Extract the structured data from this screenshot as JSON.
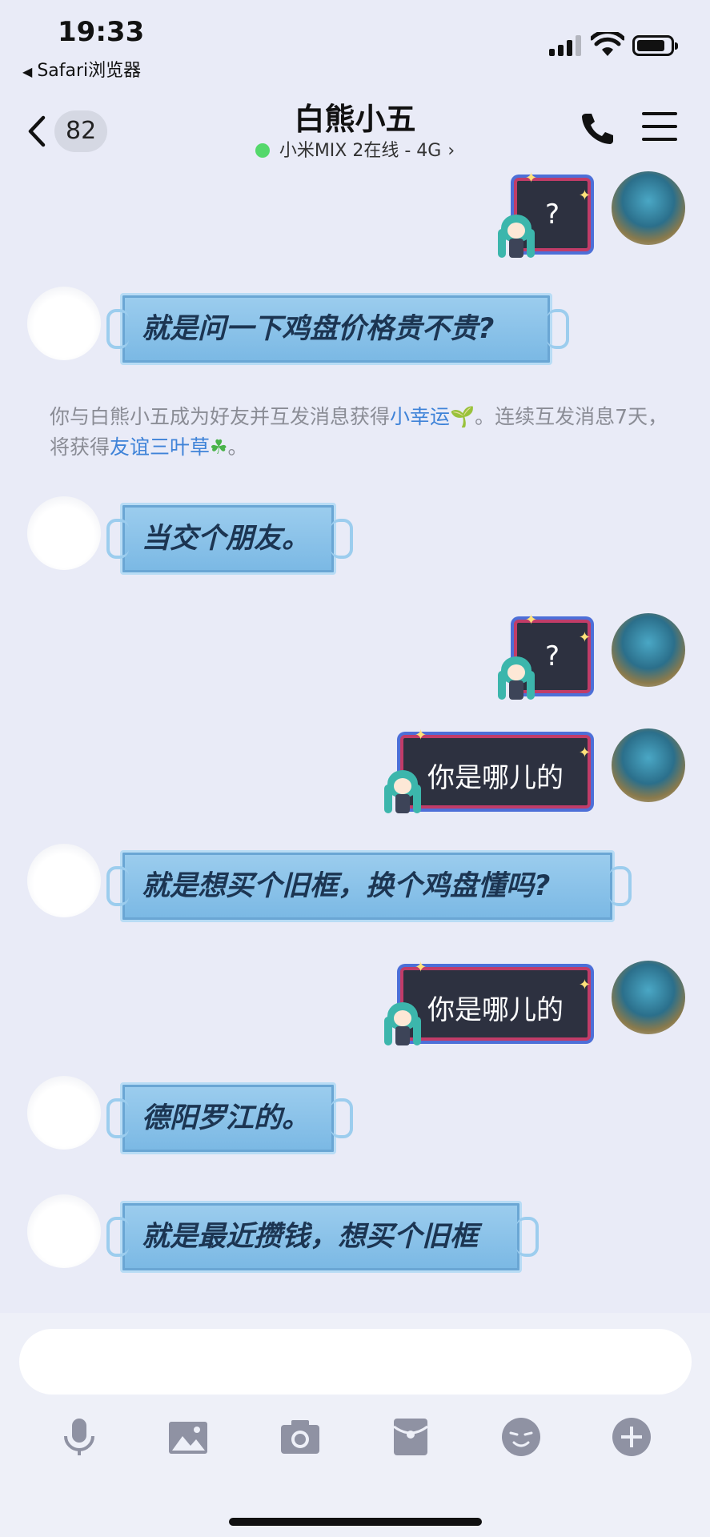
{
  "status_bar": {
    "time": "19:33",
    "back_app_label": "Safari浏览器"
  },
  "header": {
    "unread_count": "82",
    "title": "白熊小五",
    "subtitle": "小米MIX 2在线 - 4G",
    "online_color": "#54d86b"
  },
  "messages": [
    {
      "side": "out",
      "text": "?"
    },
    {
      "side": "in",
      "text": "就是问一下鸡盘价格贵不贵?"
    },
    {
      "side": "in",
      "text": "当交个朋友。"
    },
    {
      "side": "out",
      "text": "?"
    },
    {
      "side": "out",
      "text": "你是哪儿的"
    },
    {
      "side": "in",
      "text": "就是想买个旧框，换个鸡盘懂吗?"
    },
    {
      "side": "out",
      "text": "你是哪儿的"
    },
    {
      "side": "in",
      "text": "德阳罗江的。"
    },
    {
      "side": "in",
      "text": "就是最近攒钱，想买个旧框"
    }
  ],
  "system_notice": {
    "part1": "你与白熊小五成为好友并互发消息获得",
    "link1": "小幸运",
    "part2": "。连续互发消息7天，将获得",
    "link2": "友谊三叶草",
    "part3": "。"
  },
  "input": {
    "value": ""
  },
  "toolbar": {
    "icons": [
      "microphone-icon",
      "image-icon",
      "camera-icon",
      "red-packet-icon",
      "emoji-icon",
      "plus-icon"
    ]
  },
  "colors": {
    "background": "#e9ebf7",
    "incoming_bubble": "#7ab8e4",
    "outgoing_bubble": "#2d3140",
    "outgoing_border": "#c13c68",
    "link": "#3f83d8"
  }
}
